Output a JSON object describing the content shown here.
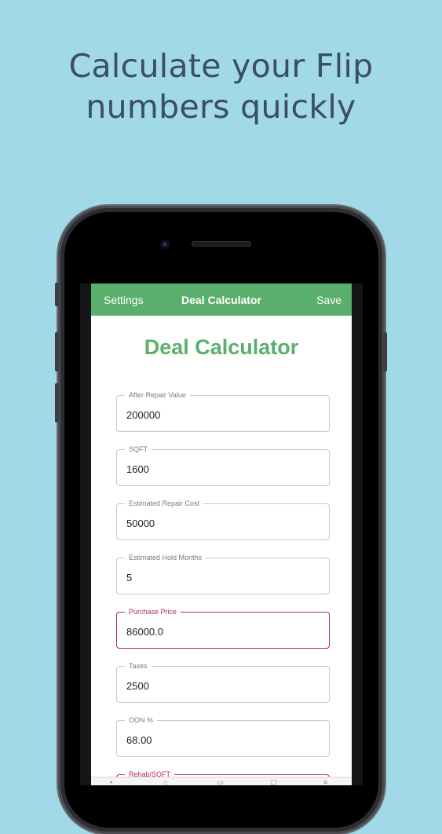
{
  "headline": {
    "line1": "Calculate your Flip",
    "line2": "numbers quickly"
  },
  "app": {
    "navbar": {
      "left": "Settings",
      "title": "Deal Calculator",
      "right": "Save"
    },
    "page_title": "Deal Calculator",
    "fields": [
      {
        "label": "After Repair Value",
        "value": "200000"
      },
      {
        "label": "SQFT",
        "value": "1600"
      },
      {
        "label": "Estimated Repair Cost",
        "value": "50000"
      },
      {
        "label": "Estimated Hold Months",
        "value": "5"
      },
      {
        "label": "Purchase Price",
        "value": "86000.0",
        "active": true
      },
      {
        "label": "Taxes",
        "value": "2500"
      },
      {
        "label": "OON %",
        "value": "68.00"
      },
      {
        "label": "Rehab/SQFT",
        "value": ""
      }
    ],
    "tabs": [
      "calculator-tab-icon",
      "home-tab-icon",
      "photos-tab-icon",
      "notes-tab-icon",
      "list-tab-icon"
    ]
  },
  "colors": {
    "background": "#a2d9e6",
    "accent": "#5aaf6c",
    "active_field": "#b32d4e",
    "headline": "#3a4e66"
  }
}
